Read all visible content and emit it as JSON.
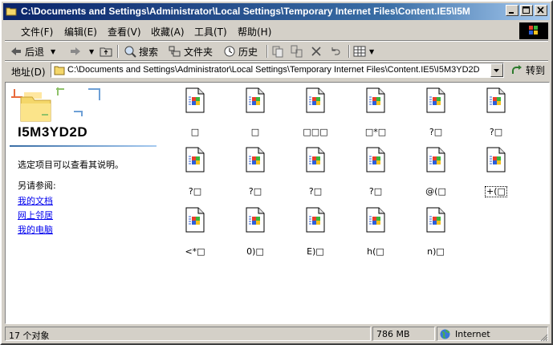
{
  "window": {
    "title": "C:\\Documents and Settings\\Administrator\\Local Settings\\Temporary Internet Files\\Content.IE5\\I5M"
  },
  "menu": [
    "文件(F)",
    "编辑(E)",
    "查看(V)",
    "收藏(A)",
    "工具(T)",
    "帮助(H)"
  ],
  "toolbar": {
    "back": "后退",
    "search": "搜索",
    "folders": "文件夹",
    "history": "历史"
  },
  "address": {
    "label": "地址(D)",
    "value": "C:\\Documents and Settings\\Administrator\\Local Settings\\Temporary Internet Files\\Content.IE5\\I5M3YD2D",
    "go": "转到"
  },
  "left_panel": {
    "folder_name": "I5M3YD2D",
    "description": "选定项目可以查看其说明。",
    "see_also": "另请参阅:",
    "links": [
      "我的文档",
      "网上邻居",
      "我的电脑"
    ]
  },
  "files": [
    {
      "name": "□"
    },
    {
      "name": "□"
    },
    {
      "name": "□□□"
    },
    {
      "name": "□*□"
    },
    {
      "name": "?□"
    },
    {
      "name": "?□"
    },
    {
      "name": "?□"
    },
    {
      "name": "?□"
    },
    {
      "name": "?□"
    },
    {
      "name": "?□"
    },
    {
      "name": "@(□"
    },
    {
      "name": "+(□"
    },
    {
      "name": "<*□"
    },
    {
      "name": "0)□"
    },
    {
      "name": "E)□"
    },
    {
      "name": "h(□"
    },
    {
      "name": "n)□"
    }
  ],
  "status": {
    "count": "17 个对象",
    "size": "786 MB",
    "zone": "Internet"
  },
  "colors": {
    "title_start": "#0a246a",
    "title_end": "#a6caf0",
    "link": "#0000ee"
  }
}
